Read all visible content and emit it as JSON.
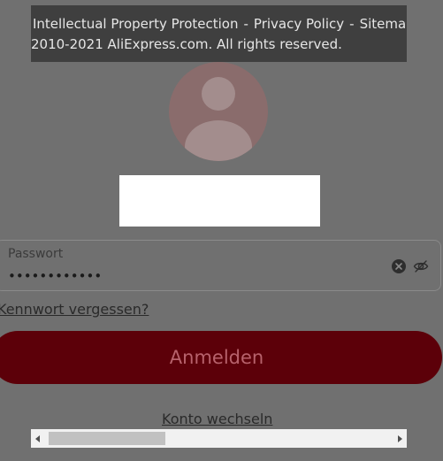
{
  "footer": {
    "links": [
      "Intellectual Property Protection",
      "Privacy Policy",
      "Sitemap"
    ],
    "separator": "-",
    "copyright": "2010-2021 AliExpress.com. All rights reserved."
  },
  "login": {
    "password_label": "Passwort",
    "password_value": "••••••••••••",
    "forgot_label": "Kennwort vergessen?",
    "submit_label": "Anmelden",
    "switch_account_label": "Konto wechseln"
  },
  "icons": {
    "avatar": "user-avatar-icon",
    "clear": "clear-icon",
    "visibility": "eye-off-icon",
    "scroll_left": "arrow-left-icon",
    "scroll_right": "arrow-right-icon"
  },
  "colors": {
    "overlay": "#707070",
    "tooltip_bg": "#3f3f3f",
    "button_bg": "#5c0009",
    "button_text": "#b7626c"
  }
}
